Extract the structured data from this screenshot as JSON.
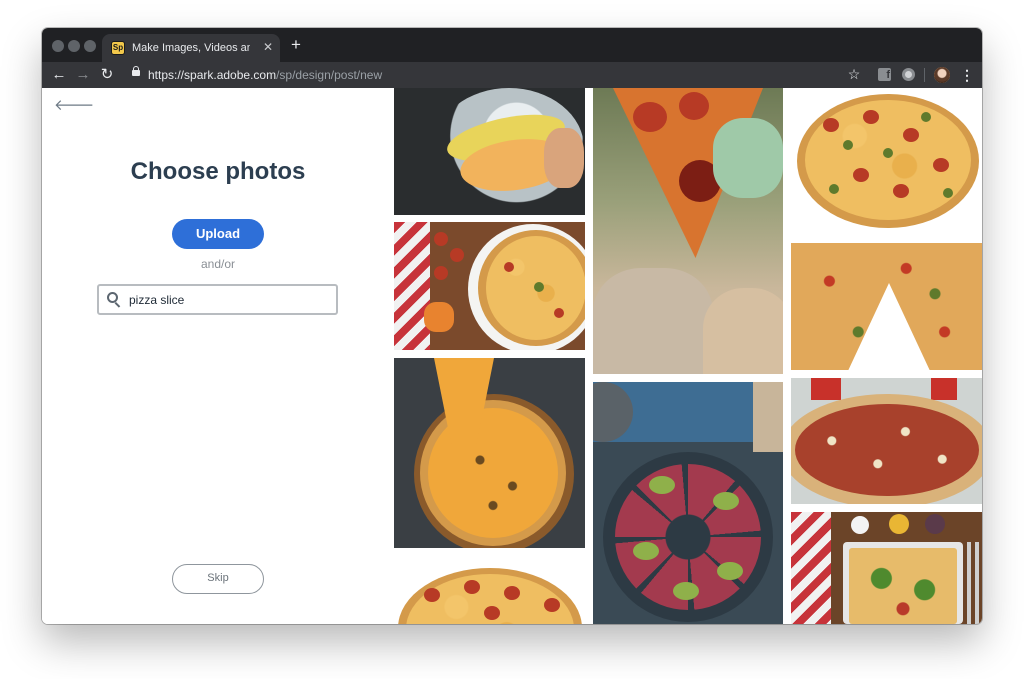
{
  "browser": {
    "tab": {
      "favicon_text": "Sp",
      "title": "Make Images, Videos and Web",
      "close_glyph": "✕"
    },
    "new_tab_glyph": "+",
    "nav": {
      "back_glyph": "←",
      "forward_glyph": "→",
      "reload_glyph": "↻"
    },
    "address": {
      "host": "https://spark.adobe.com",
      "path": "/sp/design/post/new"
    },
    "star_glyph": "☆",
    "extensions": [
      "facebook-icon",
      "circle-extension-icon"
    ],
    "menu_glyph": "⋮"
  },
  "panel": {
    "back_glyph": "🡐",
    "heading": "Choose photos",
    "upload_label": "Upload",
    "andor_label": "and/or",
    "search": {
      "value": "pizza slice"
    },
    "skip_label": "Skip"
  },
  "photos": [
    "melon-bowl-photo",
    "pizza-slice-stretch-photo",
    "jalapeno-pepperoni-pizza-photo",
    "pizza-table-spread-photo",
    "cut-pizza-missing-slice-photo",
    "cheesy-pizza-hand-lift-photo",
    "avocado-pizza-slate-photo",
    "deep-dish-pizza-photo",
    "pizza-tray-arugula-photo",
    "pepperoni-pizza-bottom-photo"
  ],
  "colors": {
    "upload_button": "#2e6fd8",
    "heading": "#2c3e50",
    "chrome_dark": "#202124",
    "toolbar": "#35363a"
  }
}
